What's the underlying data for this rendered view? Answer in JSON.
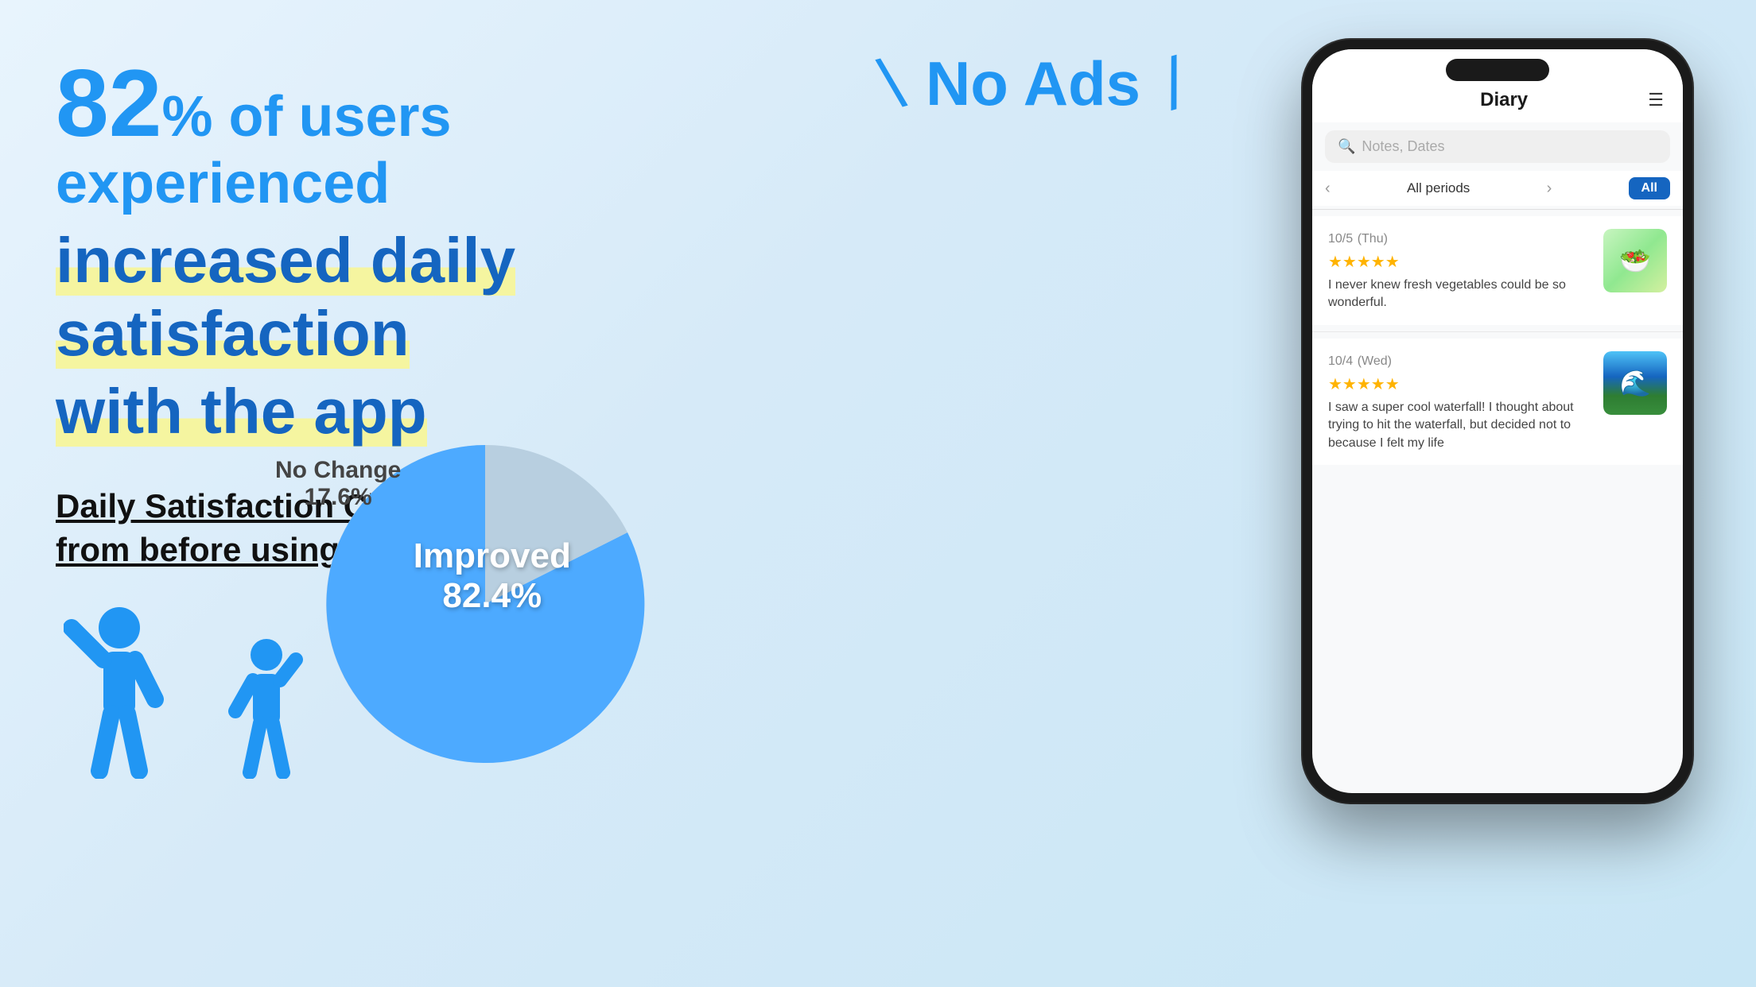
{
  "headline": {
    "number": "82",
    "percent_text": "% of users experienced",
    "line2": "increased daily satisfaction",
    "line3": "with the app"
  },
  "no_ads": {
    "text": "No Ads",
    "slash_left": "\\",
    "slash_right": "/"
  },
  "chart_section": {
    "title_line1": "Daily Satisfaction Change",
    "title_line2": "from before using the app",
    "improved_label": "Improved",
    "improved_pct": "82.4%",
    "no_change_label": "No Change",
    "no_change_pct": "17.6%"
  },
  "phone": {
    "title": "Diary",
    "search_placeholder": "Notes, Dates",
    "period_label": "All periods",
    "period_btn": "All",
    "entries": [
      {
        "date": "10/5",
        "day": "(Thu)",
        "stars": 5,
        "text": "I never knew fresh vegetables could be so wonderful.",
        "image_type": "food"
      },
      {
        "date": "10/4",
        "day": "(Wed)",
        "stars": 5,
        "text": "I saw a super cool waterfall! I thought about trying to hit the waterfall, but decided not to because I felt my life",
        "image_type": "waterfall"
      }
    ]
  }
}
